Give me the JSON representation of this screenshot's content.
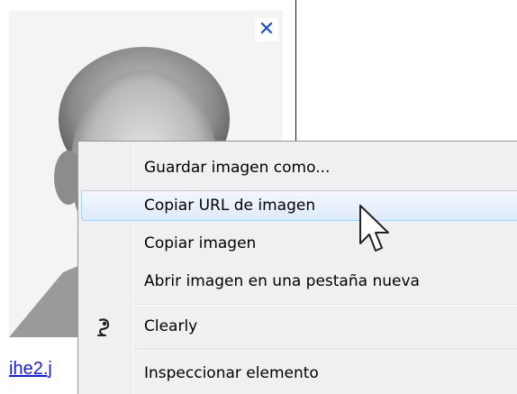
{
  "image_link": {
    "text": "ihe2.j"
  },
  "close_button": {
    "glyph": "✕",
    "icon": "close-icon",
    "color": "#1f4fb8"
  },
  "context_menu": {
    "items": [
      {
        "label": "Guardar imagen como..."
      },
      {
        "label": "Copiar URL de imagen",
        "highlighted": true
      },
      {
        "label": "Copiar imagen"
      },
      {
        "label": "Abrir imagen en una pestaña nueva"
      },
      {
        "label": "Clearly",
        "icon": "clearly-extension-icon"
      },
      {
        "label": "Inspeccionar elemento"
      }
    ]
  },
  "colors": {
    "menu_background": "#f0f0f0",
    "highlight_border": "#aecff7",
    "link": "#1a1ae0"
  }
}
